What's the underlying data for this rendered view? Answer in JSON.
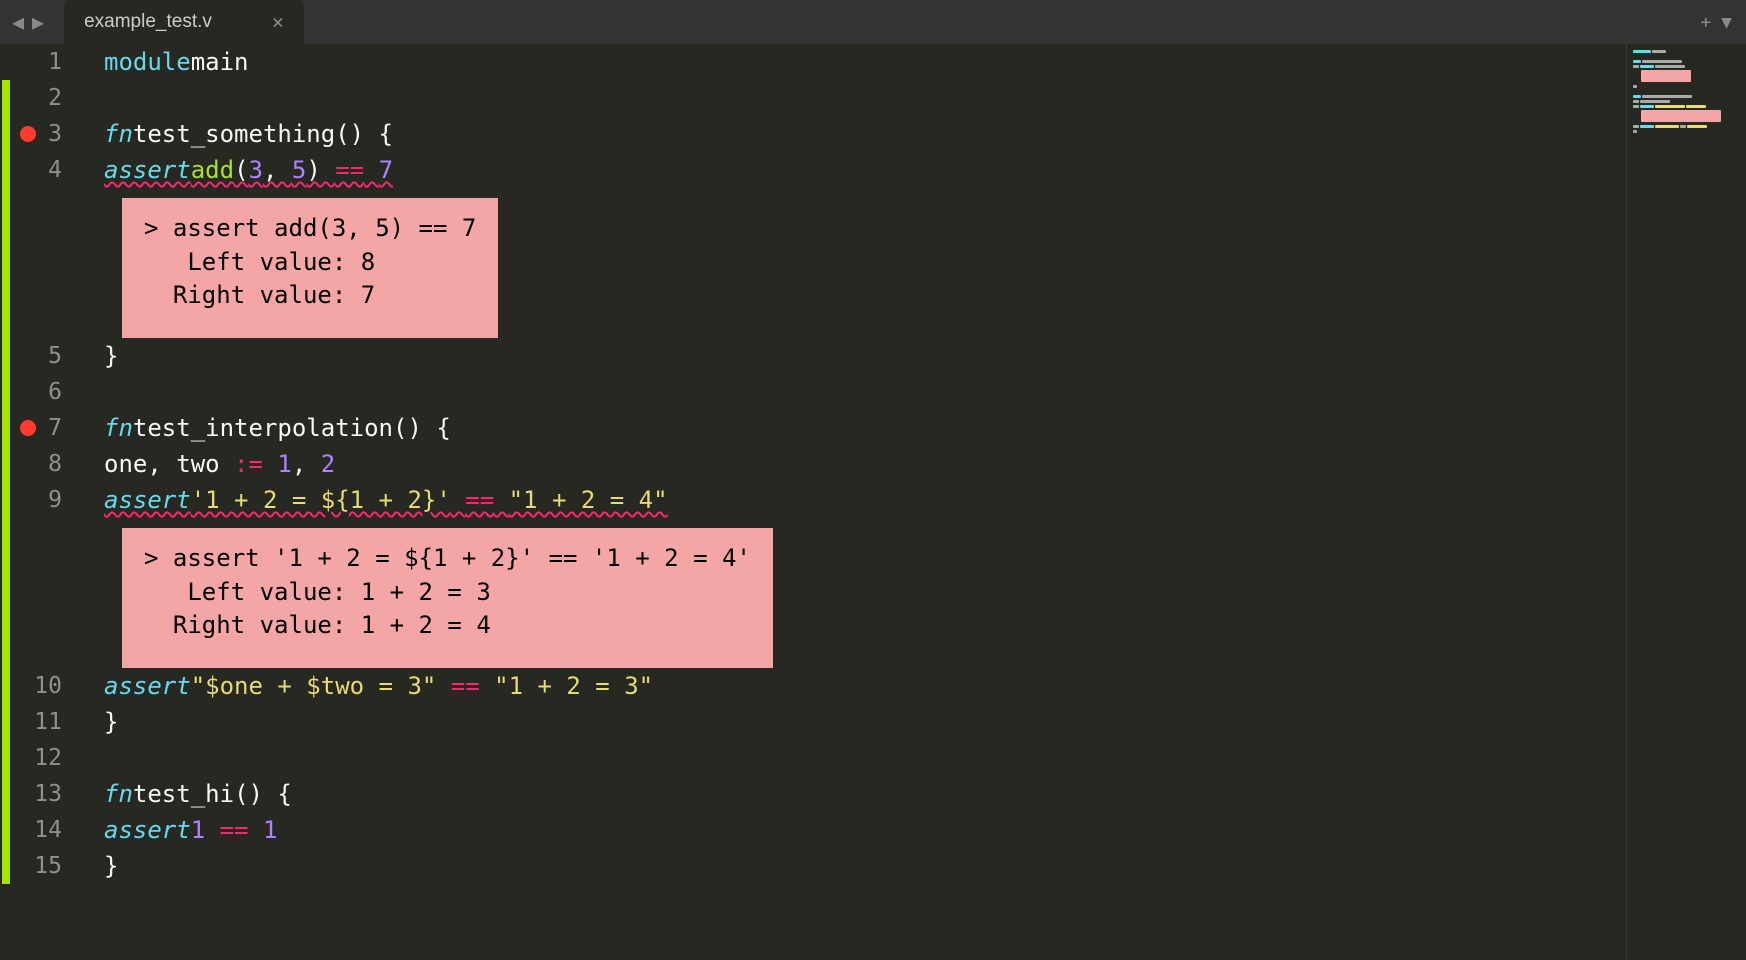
{
  "tab": {
    "name": "example_test.v",
    "close": "×"
  },
  "nav": {
    "back": "◀",
    "forward": "▶",
    "plus": "+",
    "dropdown": "▼"
  },
  "lines": {
    "l1": {
      "num": "1",
      "module": "module",
      "name": "main"
    },
    "l2": {
      "num": "2"
    },
    "l3": {
      "num": "3",
      "fn": "fn",
      "name": "test_something",
      "rest": "() {"
    },
    "l4": {
      "num": "4",
      "assert": "assert",
      "call": "add",
      "args_open": "(",
      "a1": "3",
      "comma": ", ",
      "a2": "5",
      "args_close": ") ",
      "eq": "==",
      "sp": " ",
      "res": "7"
    },
    "err1": "> assert add(3, 5) == 7\n   Left value: 8\n  Right value: 7",
    "l5": {
      "num": "5",
      "text": "}"
    },
    "l6": {
      "num": "6"
    },
    "l7": {
      "num": "7",
      "fn": "fn",
      "name": "test_interpolation",
      "rest": "() {"
    },
    "l8": {
      "num": "8",
      "vars": "one, two ",
      "op": ":=",
      "vals": " ",
      "v1": "1",
      "comma": ", ",
      "v2": "2"
    },
    "l9": {
      "num": "9",
      "assert": "assert",
      "s1": "'1 + 2 = ${1 + 2}'",
      "sp1": " ",
      "eq": "==",
      "sp2": " ",
      "s2": "\"1 + 2 = 4\""
    },
    "err2": "> assert '1 + 2 = ${1 + 2}' == '1 + 2 = 4'\n   Left value: 1 + 2 = 3\n  Right value: 1 + 2 = 4",
    "l10": {
      "num": "10",
      "assert": "assert",
      "s1": "\"$one + $two = 3\"",
      "sp1": " ",
      "eq": "==",
      "sp2": " ",
      "s2": "\"1 + 2 = 3\""
    },
    "l11": {
      "num": "11",
      "text": "}"
    },
    "l12": {
      "num": "12"
    },
    "l13": {
      "num": "13",
      "fn": "fn",
      "name": "test_hi",
      "rest": "() {"
    },
    "l14": {
      "num": "14",
      "assert": "assert",
      "a1": "1",
      "sp1": " ",
      "eq": "==",
      "sp2": " ",
      "a2": "1"
    },
    "l15": {
      "num": "15",
      "text": "}"
    }
  }
}
